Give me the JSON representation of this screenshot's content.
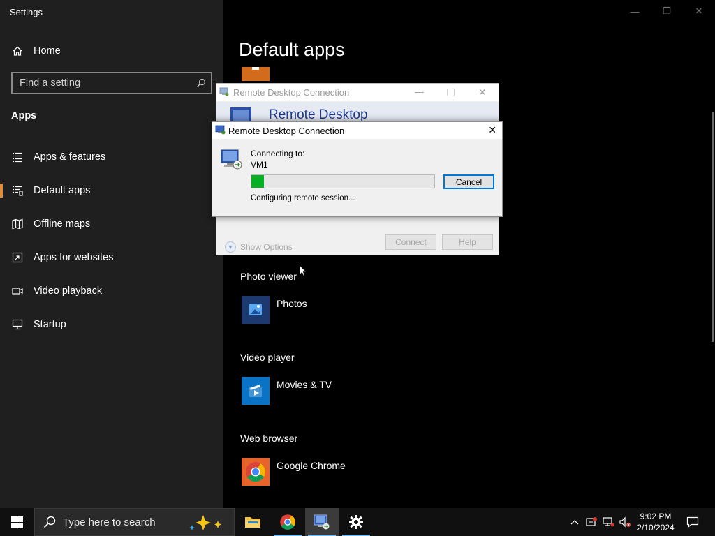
{
  "window": {
    "title": "Settings"
  },
  "sidebar": {
    "home_label": "Home",
    "search_placeholder": "Find a setting",
    "section_heading": "Apps",
    "items": [
      {
        "label": "Apps & features",
        "icon": "apps-features-icon"
      },
      {
        "label": "Default apps",
        "icon": "default-apps-icon",
        "selected": true
      },
      {
        "label": "Offline maps",
        "icon": "offline-maps-icon"
      },
      {
        "label": "Apps for websites",
        "icon": "apps-for-websites-icon"
      },
      {
        "label": "Video playback",
        "icon": "video-playback-icon"
      },
      {
        "label": "Startup",
        "icon": "startup-icon"
      }
    ]
  },
  "main": {
    "title": "Default apps",
    "categories": [
      {
        "label": "Photo viewer",
        "app": "Photos"
      },
      {
        "label": "Video player",
        "app": "Movies & TV"
      },
      {
        "label": "Web browser",
        "app": "Google Chrome"
      }
    ]
  },
  "rdc_window": {
    "title": "Remote Desktop Connection",
    "banner": "Remote Desktop",
    "show_options": "Show Options",
    "connect": "Connect",
    "help": "Help"
  },
  "rdc_dialog": {
    "title": "Remote Desktop Connection",
    "connecting_to": "Connecting to:",
    "host": "VM1",
    "progress": 0.07,
    "status": "Configuring remote session...",
    "cancel": "Cancel"
  },
  "taskbar": {
    "search_placeholder": "Type here to search",
    "apps": [
      "file-explorer",
      "google-chrome",
      "remote-desktop-connection",
      "settings"
    ],
    "time": "9:02 PM",
    "date": "2/10/2024"
  },
  "colors": {
    "accent": "#e08b3a",
    "progress": "#06b025",
    "focus_border": "#0078d7",
    "sidebar_bg": "#1f1f1f",
    "taskbar_bg": "#101010"
  }
}
